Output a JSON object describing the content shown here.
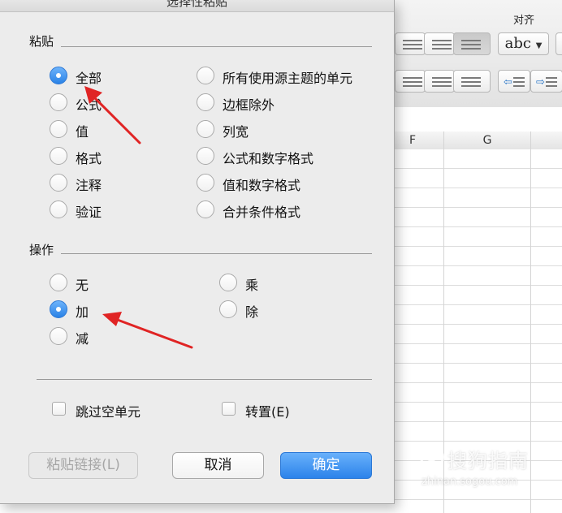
{
  "dialog": {
    "title": "选择性粘贴",
    "paste_section": {
      "label": "粘贴",
      "options_left": [
        {
          "label": "全部",
          "checked": true
        },
        {
          "label": "公式",
          "checked": false
        },
        {
          "label": "值",
          "checked": false
        },
        {
          "label": "格式",
          "checked": false
        },
        {
          "label": "注释",
          "checked": false
        },
        {
          "label": "验证",
          "checked": false
        }
      ],
      "options_right": [
        {
          "label": "所有使用源主题的单元",
          "checked": false
        },
        {
          "label": "边框除外",
          "checked": false
        },
        {
          "label": "列宽",
          "checked": false
        },
        {
          "label": "公式和数字格式",
          "checked": false
        },
        {
          "label": "值和数字格式",
          "checked": false
        },
        {
          "label": "合并条件格式",
          "checked": false
        }
      ]
    },
    "operation_section": {
      "label": "操作",
      "options_left": [
        {
          "label": "无",
          "checked": false
        },
        {
          "label": "加",
          "checked": true
        },
        {
          "label": "减",
          "checked": false
        }
      ],
      "options_right": [
        {
          "label": "乘",
          "checked": false
        },
        {
          "label": "除",
          "checked": false
        }
      ]
    },
    "checkboxes": {
      "skip_blanks": {
        "label": "跳过空单元",
        "checked": false
      },
      "transpose": {
        "label": "转置(E)",
        "checked": false
      }
    },
    "buttons": {
      "paste_link": "粘贴链接(L)",
      "cancel": "取消",
      "ok": "确定"
    }
  },
  "ribbon": {
    "group_label": "对齐",
    "orientation_button": "abc",
    "icons": [
      "align-center-icon",
      "align-right-icon",
      "justify-icon",
      "decrease-indent-icon",
      "increase-indent-icon"
    ]
  },
  "sheet": {
    "columns": [
      "F",
      "G"
    ]
  },
  "annotations": {
    "arrow_color": "#e02424"
  },
  "watermark": {
    "text": "搜狗指南",
    "url": "zhinan.sogou.com"
  },
  "colors": {
    "accent": "#2c83ea",
    "dialog_bg": "#ececec"
  }
}
